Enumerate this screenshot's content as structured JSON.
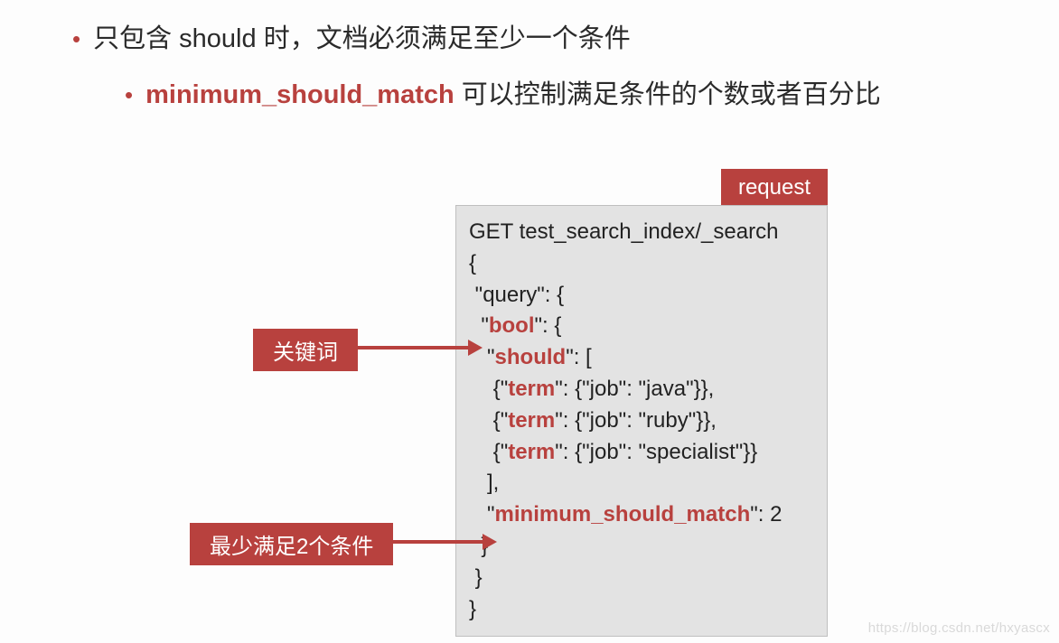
{
  "bullet1": {
    "prefix": "只包含 ",
    "kw": "should",
    "suffix": " 时，文档必须满足至少一个条件"
  },
  "bullet2": {
    "kw": "minimum_should_match",
    "suffix": " 可以控制满足条件的个数或者百分比"
  },
  "tab_label": "request",
  "code": {
    "l0": "GET test_search_index/_search",
    "l1": "{",
    "l2_a": " \"query\": {",
    "l3_a": "  \"",
    "l3_kw": "bool",
    "l3_b": "\": {",
    "l4_a": "   \"",
    "l4_kw": "should",
    "l4_b": "\": [",
    "l5_a": "    {\"",
    "l5_kw": "term",
    "l5_b": "\": {\"job\": \"java\"}},",
    "l6_a": "    {\"",
    "l6_kw": "term",
    "l6_b": "\": {\"job\": \"ruby\"}},",
    "l7_a": "    {\"",
    "l7_kw": "term",
    "l7_b": "\": {\"job\": \"specialist\"}}",
    "l8": "   ],",
    "l9_a": "   \"",
    "l9_kw": "minimum_should_match",
    "l9_b": "\": 2",
    "l10": "  }",
    "l11": " }",
    "l12": "}"
  },
  "labels": {
    "keyword": "关键词",
    "min2": "最少满足2个条件"
  },
  "watermark": "https://blog.csdn.net/hxyascx"
}
